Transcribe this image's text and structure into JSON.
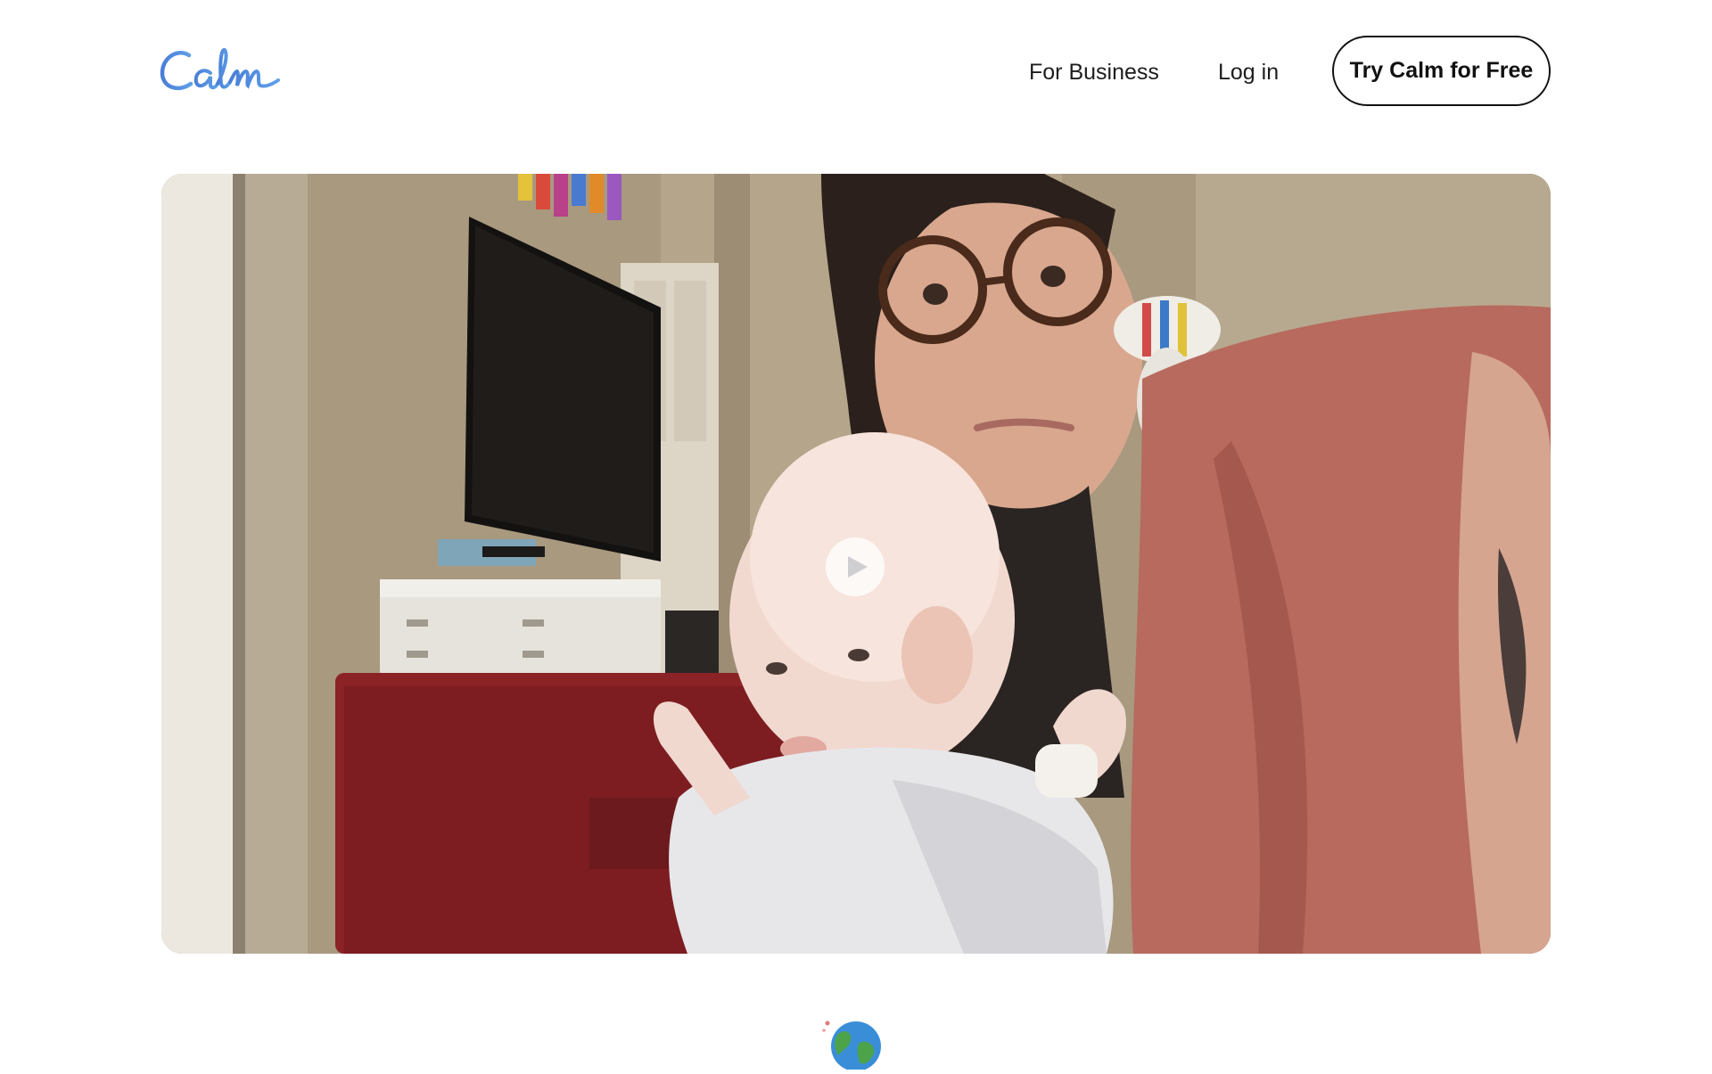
{
  "header": {
    "logo_text": "Calm",
    "nav": {
      "for_business": "For Business",
      "log_in": "Log in"
    },
    "cta_label": "Try Calm for Free"
  },
  "video": {
    "play_icon": "play-icon"
  },
  "footer_icon": "globe-icon",
  "colors": {
    "brand_blue": "#4f86d6",
    "text": "#1d1d1f",
    "background": "#ffffff"
  }
}
